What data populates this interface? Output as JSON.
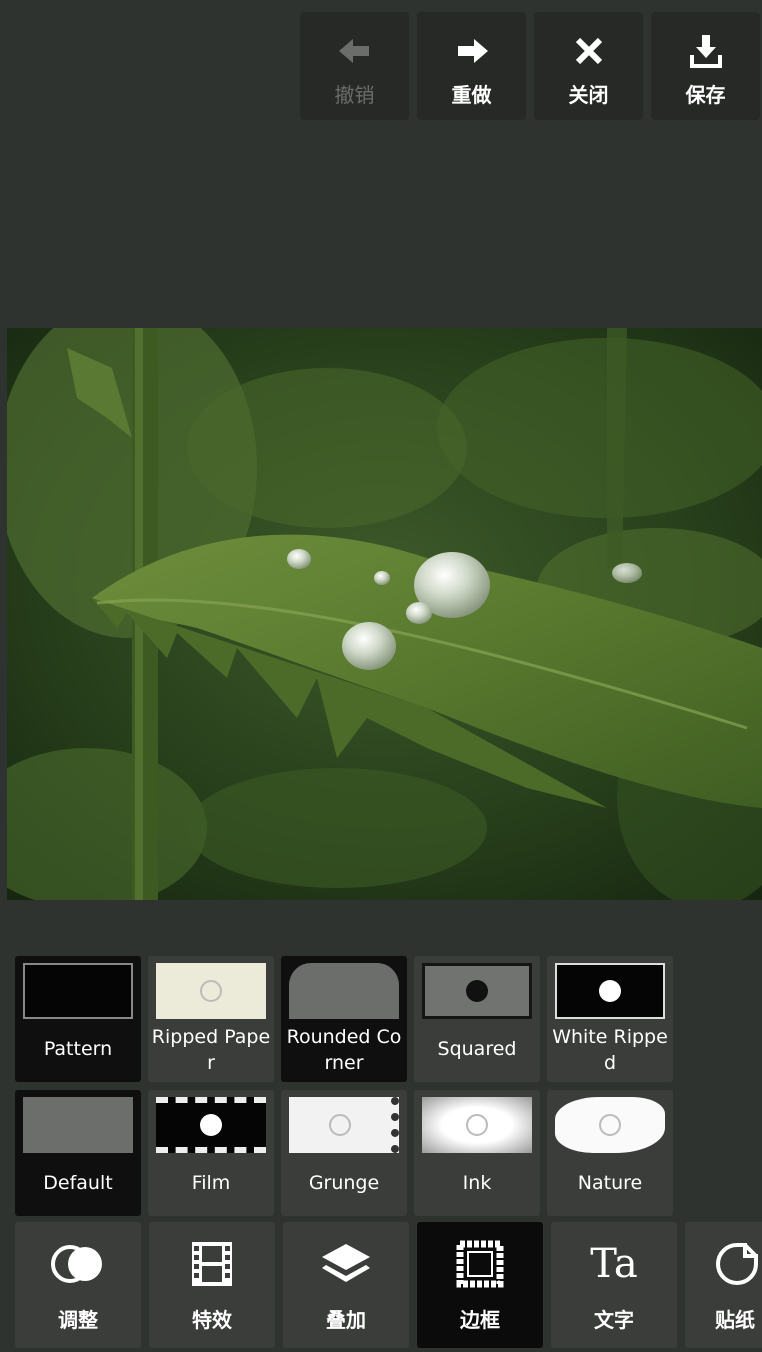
{
  "toolbar": {
    "undo": {
      "label": "撤销",
      "icon": "arrow-left-icon",
      "enabled": false
    },
    "redo": {
      "label": "重做",
      "icon": "arrow-right-icon"
    },
    "close": {
      "label": "关闭",
      "icon": "close-icon"
    },
    "save": {
      "label": "保存",
      "icon": "download-icon"
    }
  },
  "frames": [
    {
      "label": "Pattern",
      "selected": true
    },
    {
      "label": "Ripped Paper"
    },
    {
      "label": "Rounded Corner",
      "selected": true
    },
    {
      "label": "Squared"
    },
    {
      "label": "White Ripped"
    },
    {
      "label": "Default",
      "selected": true
    },
    {
      "label": "Film"
    },
    {
      "label": "Grunge"
    },
    {
      "label": "Ink"
    },
    {
      "label": "Nature"
    }
  ],
  "tools": [
    {
      "label": "调整",
      "icon": "adjust-circles-icon"
    },
    {
      "label": "特效",
      "icon": "film-strip-icon"
    },
    {
      "label": "叠加",
      "icon": "layers-icon"
    },
    {
      "label": "边框",
      "icon": "frame-border-icon",
      "active": true
    },
    {
      "label": "文字",
      "icon": "text-ta-icon",
      "glyph": "Ta"
    },
    {
      "label": "贴纸",
      "icon": "sticker-icon"
    }
  ],
  "colors": {
    "background": "#2f3330",
    "tile": "#3a3d3a",
    "selected_tile": "#0e0f0e"
  }
}
